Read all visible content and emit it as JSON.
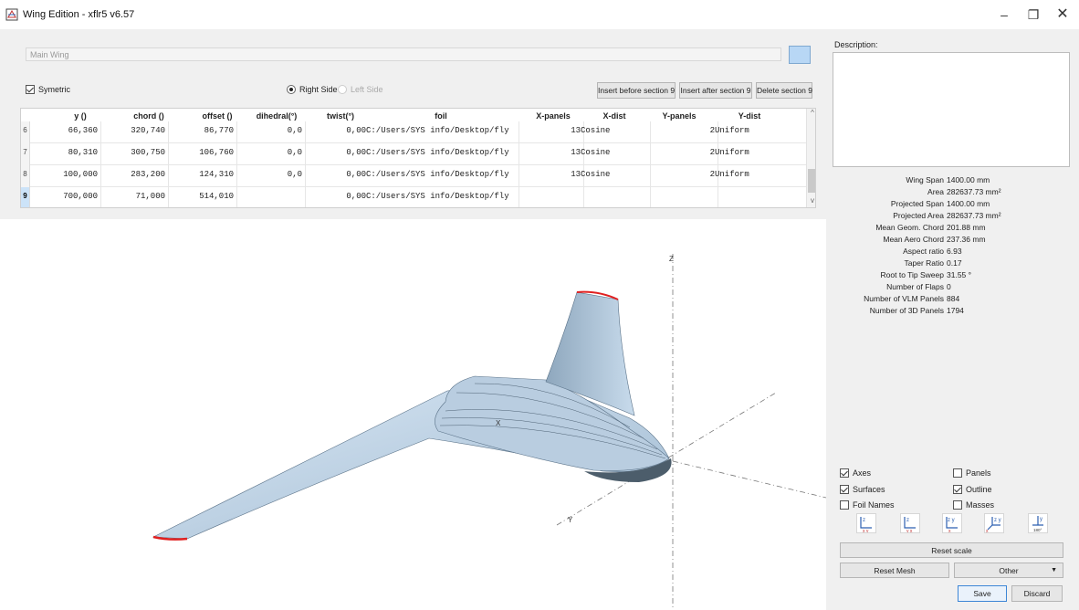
{
  "window": {
    "title": "Wing Edition - xflr5 v6.57",
    "minimize_glyph": "–",
    "maximize_glyph": "❐",
    "close_glyph": "✕"
  },
  "wing": {
    "name_placeholder": "Main Wing",
    "color": "#b8d7f5",
    "symetric_label": "Symetric",
    "symetric_checked": true,
    "right_side_label": "Right Side",
    "left_side_label": "Left Side",
    "insert_before_label": "Insert before section 9",
    "insert_after_label": "Insert after section 9",
    "delete_label": "Delete section 9"
  },
  "table": {
    "headers": [
      "y ()",
      "chord ()",
      "offset ()",
      "dihedral(°)",
      "twist(°)",
      "foil",
      "X-panels",
      "X-dist",
      "Y-panels",
      "Y-dist"
    ],
    "rows": [
      {
        "num": "6",
        "y": "66,360",
        "chord": "320,740",
        "offset": "86,770",
        "dihedral": "0,0",
        "twist": "0,00",
        "foil": "C:/Users/SYS info/Desktop/fly",
        "xpanels": "13",
        "xdist": "Cosine",
        "ypanels": "2",
        "ydist": "Uniform"
      },
      {
        "num": "7",
        "y": "80,310",
        "chord": "300,750",
        "offset": "106,760",
        "dihedral": "0,0",
        "twist": "0,00",
        "foil": "C:/Users/SYS info/Desktop/fly",
        "xpanels": "13",
        "xdist": "Cosine",
        "ypanels": "2",
        "ydist": "Uniform"
      },
      {
        "num": "8",
        "y": "100,000",
        "chord": "283,200",
        "offset": "124,310",
        "dihedral": "0,0",
        "twist": "0,00",
        "foil": "C:/Users/SYS info/Desktop/fly",
        "xpanels": "13",
        "xdist": "Cosine",
        "ypanels": "2",
        "ydist": "Uniform"
      },
      {
        "num": "9",
        "y": "700,000",
        "chord": "71,000",
        "offset": "514,010",
        "dihedral": "",
        "twist": "0,00",
        "foil": "C:/Users/SYS info/Desktop/fly",
        "xpanels": "",
        "xdist": "",
        "ypanels": "",
        "ydist": ""
      }
    ]
  },
  "viewer": {
    "axis_z": "Z",
    "axis_x": "X",
    "axis_y": "Y",
    "surface_color": "#c6dcef",
    "outline_color": "#e02020"
  },
  "description": {
    "label": "Description:"
  },
  "properties": [
    {
      "label": "Wing Span",
      "value": "1400.00 mm"
    },
    {
      "label": "Area",
      "value": "282637.73 mm²"
    },
    {
      "label": "Projected Span",
      "value": "1400.00 mm"
    },
    {
      "label": "Projected Area",
      "value": "282637.73 mm²"
    },
    {
      "label": "Mean Geom. Chord",
      "value": "201.88 mm"
    },
    {
      "label": "Mean Aero Chord",
      "value": "237.36 mm"
    },
    {
      "label": "Aspect ratio",
      "value": "6.93"
    },
    {
      "label": "Taper Ratio",
      "value": "0.17"
    },
    {
      "label": "Root to Tip Sweep",
      "value": "31.55 °"
    },
    {
      "label": "Number of Flaps",
      "value": "0"
    },
    {
      "label": "Number of VLM Panels",
      "value": "884"
    },
    {
      "label": "Number of 3D Panels",
      "value": "1794"
    }
  ],
  "display": {
    "axes": {
      "label": "Axes",
      "checked": true
    },
    "panels": {
      "label": "Panels",
      "checked": false
    },
    "surfaces": {
      "label": "Surfaces",
      "checked": true
    },
    "outline": {
      "label": "Outline",
      "checked": true
    },
    "foil_names": {
      "label": "Foil Names",
      "checked": false
    },
    "masses": {
      "label": "Masses",
      "checked": false
    }
  },
  "view_buttons": [
    {
      "icon": "view-x-icon",
      "top": "z",
      "bottom": "x y"
    },
    {
      "icon": "view-y-icon",
      "top": "z",
      "bottom": "y x"
    },
    {
      "icon": "view-z-icon",
      "top": "z y",
      "bottom": "x"
    },
    {
      "icon": "view-iso-icon",
      "top": "z y",
      "bottom": "x"
    },
    {
      "icon": "flip-180-icon",
      "top": "y",
      "bottom": "180°"
    }
  ],
  "actions": {
    "reset_scale": "Reset scale",
    "reset_mesh": "Reset Mesh",
    "other": "Other",
    "save": "Save",
    "discard": "Discard"
  }
}
